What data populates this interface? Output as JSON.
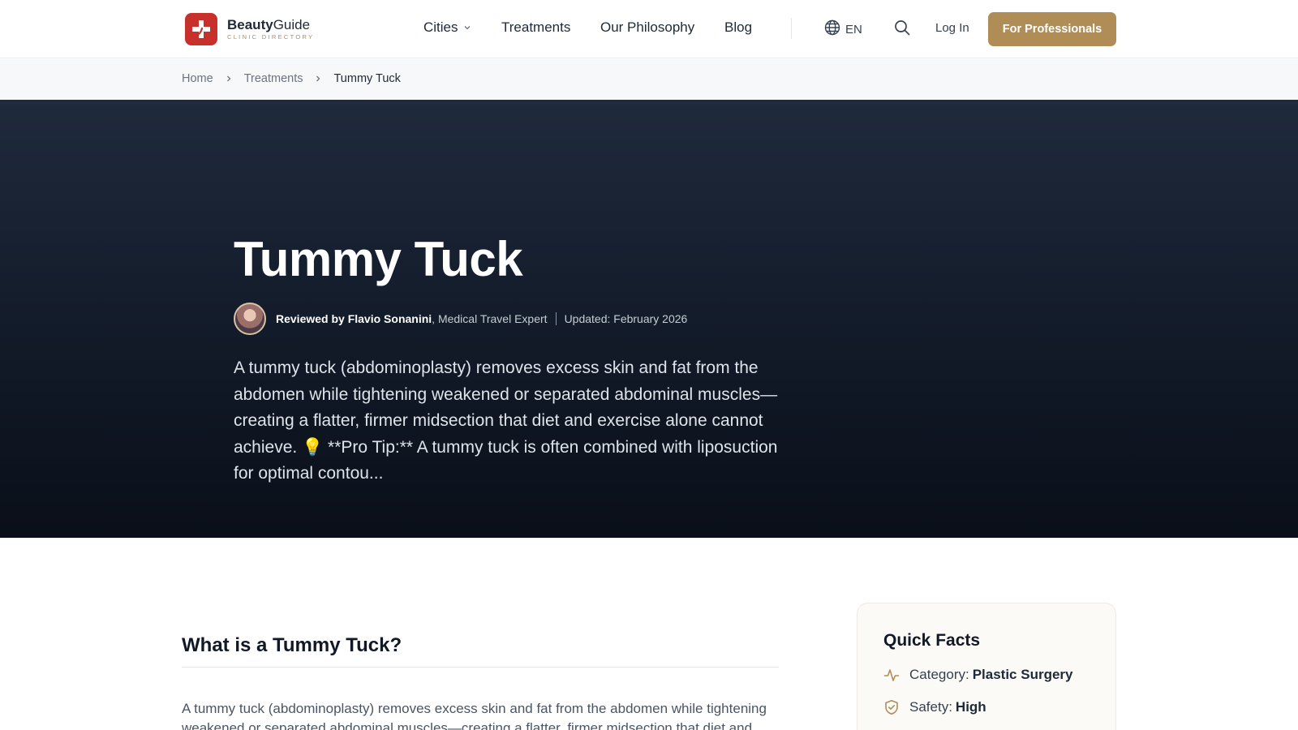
{
  "brand": {
    "name_bold": "Beauty",
    "name_rest": "Guide",
    "tagline": "CLINIC DIRECTORY",
    "accent": "#b08d57",
    "logo_color": "#c8302c"
  },
  "nav": {
    "cities": "Cities",
    "treatments": "Treatments",
    "philosophy": "Our Philosophy",
    "blog": "Blog",
    "language": "EN",
    "login": "Log In",
    "cta": "For Professionals"
  },
  "breadcrumb": {
    "home": "Home",
    "treatments": "Treatments",
    "current": "Tummy Tuck"
  },
  "hero": {
    "title": "Tummy Tuck",
    "reviewer_prefix": "Reviewed by Flavio Sonanini",
    "reviewer_role": ", Medical Travel Expert",
    "updated": "Updated: February 2026",
    "description": "A tummy tuck (abdominoplasty) removes excess skin and fat from the abdomen while tightening weakened or separated abdominal muscles—creating a flatter, firmer midsection that diet and exercise alone cannot achieve. 💡 **Pro Tip:** A tummy tuck is often combined with liposuction for optimal contou..."
  },
  "section": {
    "title": "What is a Tummy Tuck?",
    "body": "A tummy tuck (abdominoplasty) removes excess skin and fat from the abdomen while tightening weakened or separated abdominal muscles—creating a flatter, firmer midsection that diet and"
  },
  "quick_facts": {
    "title": "Quick Facts",
    "items": [
      {
        "label": "Category:",
        "value": "Plastic Surgery",
        "icon": "activity-icon"
      },
      {
        "label": "Safety:",
        "value": "High",
        "icon": "shield-check-icon"
      }
    ]
  }
}
